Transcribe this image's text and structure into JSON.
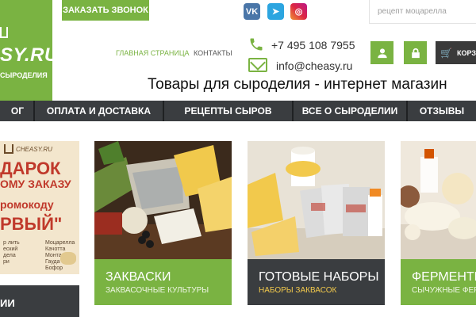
{
  "header": {
    "logo_text": "SY.RU",
    "logo_subtitle": "СЫРОДЕЛИЯ",
    "call_button": "ЗАКАЗАТЬ ЗВОНОК",
    "social": {
      "vk": "VK",
      "telegram": "➤",
      "instagram": "◎"
    },
    "search": {
      "placeholder": "рецепт моцарелла"
    },
    "nav": {
      "home": "ГЛАВНАЯ СТРАНИЦА",
      "contacts": "КОНТАКТЫ"
    },
    "phone": "+7 495 108 7955",
    "email": "info@cheasy.ru",
    "cart_label": "КОРЗ",
    "tagline": "Товары для сыроделия - интернет магазин"
  },
  "menu": {
    "items": [
      {
        "label": "ОГ"
      },
      {
        "label": "ОПЛАТА И ДОСТАВКА"
      },
      {
        "label": "РЕЦЕПТЫ СЫРОВ"
      },
      {
        "label": "ВСЕ О СЫРОДЕЛИИ"
      },
      {
        "label": "ОТЗЫВЫ"
      }
    ]
  },
  "promo": {
    "brand": "CHEASY.RU",
    "gift": "ДАРОК",
    "order": "ОМУ ЗАКАЗУ",
    "code": "ромокоду",
    "first": "РВЫЙ\"",
    "list_left": [
      "р лить",
      "еский",
      "дела",
      "ри"
    ],
    "list_right": [
      "Моцарелла",
      "Качотта",
      "Монтазио",
      "Гауда",
      "Бофор"
    ]
  },
  "sidebar_category": "ИИ",
  "cards": [
    {
      "title": "ЗАКВАСКИ",
      "subtitle": "ЗАКВАСОЧНЫЕ КУЛЬТУРЫ"
    },
    {
      "title": "ГОТОВЫЕ НАБОРЫ",
      "subtitle": "НАБОРЫ ЗАКВАСОК"
    },
    {
      "title": "ФЕРМЕНТЫ",
      "subtitle": "СЫЧУЖНЫЕ ФЕР"
    }
  ],
  "colors": {
    "brand_green": "#7ab342",
    "dark": "#3a3d40",
    "accent_yellow": "#f2c94c"
  }
}
